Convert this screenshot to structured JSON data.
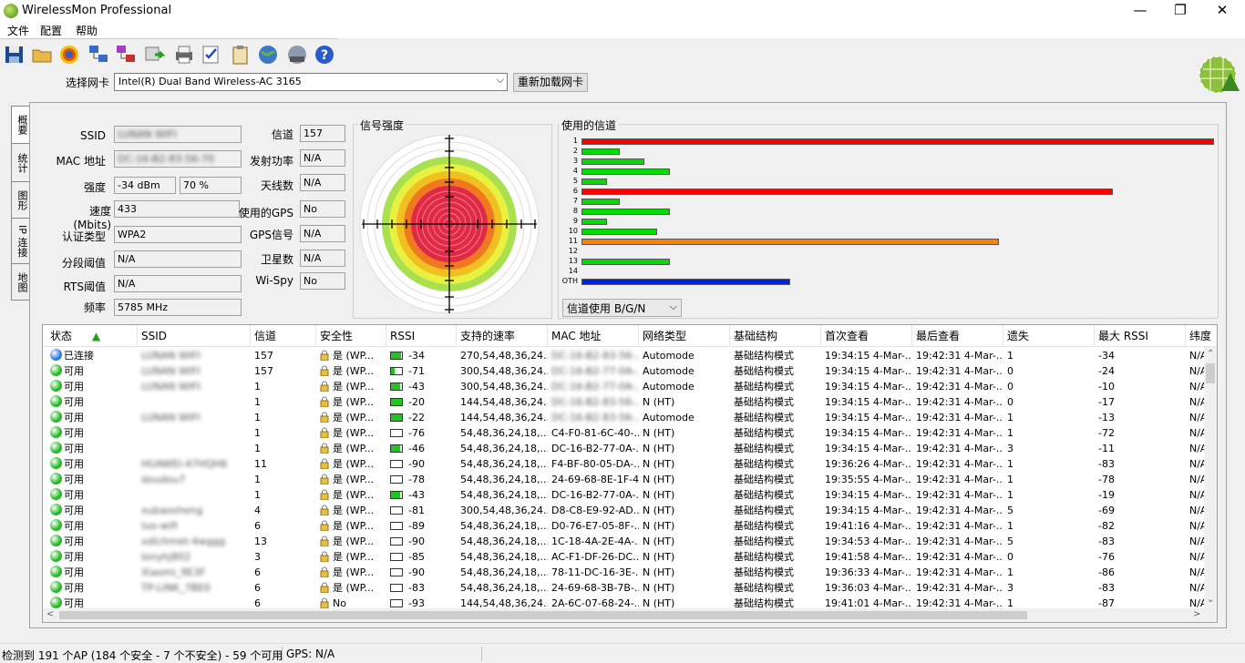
{
  "window": {
    "title": "WirelessMon Professional",
    "minimize": "—",
    "maximize": "❐",
    "close": "✕"
  },
  "menu": [
    "文件",
    "配置",
    "帮助"
  ],
  "toolbar": {
    "icons": [
      "save-icon",
      "open-folder-icon",
      "target-icon",
      "network-config-icon",
      "network-color-icon",
      "export-green-icon",
      "print-icon",
      "checklist-icon",
      "clipboard-icon",
      "globe-icon",
      "globe-gray-icon",
      "help-icon"
    ]
  },
  "nic": {
    "label": "选择网卡",
    "value": "Intel(R) Dual Band Wireless-AC 3165",
    "reload": "重新加载网卡"
  },
  "tabs": [
    "概要",
    "统计",
    "图形",
    "IP 连接",
    "地图"
  ],
  "info": {
    "ssid_label": "SSID",
    "ssid": "LUNAN WIFI",
    "mac_label": "MAC 地址",
    "mac": "DC-16-B2-83-56-70",
    "strength_label": "强度",
    "strength_dbm": "-34 dBm",
    "strength_pct": "70 %",
    "speed_label": "速度(Mbits)",
    "speed": "433",
    "auth_label": "认证类型",
    "auth": "WPA2",
    "frag_label": "分段阈值",
    "frag": "N/A",
    "rts_label": "RTS阈值",
    "rts": "N/A",
    "freq_label": "频率",
    "freq": "5785 MHz",
    "channel_label": "信道",
    "channel": "157",
    "tx_label": "发射功率",
    "tx": "N/A",
    "antenna_label": "天线数",
    "antenna": "N/A",
    "gps_used_label": "使用的GPS",
    "gps_used": "No",
    "gps_signal_label": "GPS信号",
    "gps_signal": "N/A",
    "satellites_label": "卫星数",
    "satellites": "N/A",
    "wispy_label": "Wi-Spy",
    "wispy": "No"
  },
  "signal_title": "信号强度",
  "chart_data": {
    "type": "bar",
    "title": "使用的信道",
    "categories": [
      "1",
      "2",
      "3",
      "4",
      "5",
      "6",
      "7",
      "8",
      "9",
      "10",
      "11",
      "12",
      "13",
      "14",
      "OTH"
    ],
    "values": [
      100,
      6,
      10,
      14,
      4,
      84,
      6,
      14,
      4,
      12,
      66,
      0,
      14,
      0,
      33
    ],
    "colors": [
      "#ff0000",
      "#00dd00",
      "#00dd00",
      "#00dd00",
      "#00dd00",
      "#ff0000",
      "#00dd00",
      "#00dd00",
      "#00dd00",
      "#00dd00",
      "#ff8000",
      "#00dd00",
      "#00dd00",
      "#00dd00",
      "#0022ee"
    ],
    "xlim": [
      0,
      100
    ]
  },
  "channel_select": "信道使用 B/G/N",
  "table": {
    "headers": [
      "状态",
      "SSID",
      "信道",
      "安全性",
      "RSSI",
      "支持的速率",
      "MAC 地址",
      "网络类型",
      "基础结构",
      "首次查看",
      "最后查看",
      "遗失",
      "最大 RSSI",
      "纬度"
    ],
    "rows": [
      {
        "status": "已连接",
        "dot": "#2a7ae0",
        "ssid": "LUNAN WIFI",
        "blur": true,
        "channel": "157",
        "sec": "是 (WP...",
        "rssi": "-34",
        "fill": 0.9,
        "rates": "270,54,48,36,24...",
        "mac": "DC-16-B2-83-56-...",
        "macblur": true,
        "type": "Automode",
        "infra": "基础结构模式",
        "first": "19:34:15 4-Mar-...",
        "last": "19:42:31 4-Mar-...",
        "lost": "1",
        "max": "-34",
        "lat": "N/A"
      },
      {
        "status": "可用",
        "dot": "#22b822",
        "ssid": "LUNAN WIFI",
        "blur": true,
        "channel": "157",
        "sec": "是 (WP...",
        "rssi": "-71",
        "fill": 0.3,
        "rates": "300,54,48,36,24...",
        "mac": "DC-16-B2-77-0A-...",
        "macblur": true,
        "type": "Automode",
        "infra": "基础结构模式",
        "first": "19:34:15 4-Mar-...",
        "last": "19:42:31 4-Mar-...",
        "lost": "0",
        "max": "-24",
        "lat": "N/A"
      },
      {
        "status": "可用",
        "dot": "#22b822",
        "ssid": "LUNAN WIFI",
        "blur": true,
        "channel": "1",
        "sec": "是 (WP...",
        "rssi": "-43",
        "fill": 0.8,
        "rates": "300,54,48,36,24...",
        "mac": "DC-16-B2-77-0A-...",
        "macblur": true,
        "type": "Automode",
        "infra": "基础结构模式",
        "first": "19:34:15 4-Mar-...",
        "last": "19:42:31 4-Mar-...",
        "lost": "0",
        "max": "-10",
        "lat": "N/A"
      },
      {
        "status": "可用",
        "dot": "#22b822",
        "ssid": "",
        "blur": false,
        "channel": "1",
        "sec": "是 (WP...",
        "rssi": "-20",
        "fill": 1.0,
        "rates": "144,54,48,36,24...",
        "mac": "DC-16-B2-83-56-...",
        "macblur": true,
        "type": "N (HT)",
        "infra": "基础结构模式",
        "first": "19:34:15 4-Mar-...",
        "last": "19:42:31 4-Mar-...",
        "lost": "0",
        "max": "-17",
        "lat": "N/A"
      },
      {
        "status": "可用",
        "dot": "#22b822",
        "ssid": "LUNAN WIFI",
        "blur": true,
        "channel": "1",
        "sec": "是 (WP...",
        "rssi": "-22",
        "fill": 1.0,
        "rates": "144,54,48,36,24...",
        "mac": "DC-16-B2-83-56-...",
        "macblur": true,
        "type": "Automode",
        "infra": "基础结构模式",
        "first": "19:34:15 4-Mar-...",
        "last": "19:42:31 4-Mar-...",
        "lost": "1",
        "max": "-13",
        "lat": "N/A"
      },
      {
        "status": "可用",
        "dot": "#22b822",
        "ssid": "",
        "blur": false,
        "channel": "1",
        "sec": "是 (WP...",
        "rssi": "-76",
        "fill": 0.0,
        "rates": "54,48,36,24,18,...",
        "mac": "C4-F0-81-6C-40-...",
        "macblur": false,
        "type": "N (HT)",
        "infra": "基础结构模式",
        "first": "19:34:15 4-Mar-...",
        "last": "19:42:31 4-Mar-...",
        "lost": "1",
        "max": "-72",
        "lat": "N/A"
      },
      {
        "status": "可用",
        "dot": "#22b822",
        "ssid": "",
        "blur": false,
        "channel": "1",
        "sec": "是 (WP...",
        "rssi": "-46",
        "fill": 0.8,
        "rates": "54,48,36,24,18,...",
        "mac": "DC-16-B2-77-0A-...",
        "macblur": false,
        "type": "N (HT)",
        "infra": "基础结构模式",
        "first": "19:34:15 4-Mar-...",
        "last": "19:42:31 4-Mar-...",
        "lost": "3",
        "max": "-11",
        "lat": "N/A"
      },
      {
        "status": "可用",
        "dot": "#22b822",
        "ssid": "HUAWEI-47HQH6",
        "blur": true,
        "channel": "11",
        "sec": "是 (WP...",
        "rssi": "-90",
        "fill": 0.0,
        "rates": "54,48,36,24,18,...",
        "mac": "F4-BF-80-05-DA-...",
        "macblur": false,
        "type": "N (HT)",
        "infra": "基础结构模式",
        "first": "19:36:26 4-Mar-...",
        "last": "19:42:31 4-Mar-...",
        "lost": "1",
        "max": "-83",
        "lat": "N/A"
      },
      {
        "status": "可用",
        "dot": "#22b822",
        "ssid": "doudou7",
        "blur": true,
        "channel": "1",
        "sec": "是 (WP...",
        "rssi": "-78",
        "fill": 0.0,
        "rates": "54,48,36,24,18,...",
        "mac": "24-69-68-8E-1F-48",
        "macblur": false,
        "type": "N (HT)",
        "infra": "基础结构模式",
        "first": "19:35:55 4-Mar-...",
        "last": "19:42:31 4-Mar-...",
        "lost": "1",
        "max": "-78",
        "lat": "N/A"
      },
      {
        "status": "可用",
        "dot": "#22b822",
        "ssid": "",
        "blur": false,
        "channel": "1",
        "sec": "是 (WP...",
        "rssi": "-43",
        "fill": 0.8,
        "rates": "54,48,36,24,18,...",
        "mac": "DC-16-B2-77-0A-...",
        "macblur": false,
        "type": "N (HT)",
        "infra": "基础结构模式",
        "first": "19:34:15 4-Mar-...",
        "last": "19:42:31 4-Mar-...",
        "lost": "1",
        "max": "-19",
        "lat": "N/A"
      },
      {
        "status": "可用",
        "dot": "#22b822",
        "ssid": "xubaosheng",
        "blur": true,
        "channel": "4",
        "sec": "是 (WP...",
        "rssi": "-81",
        "fill": 0.0,
        "rates": "300,54,48,36,24...",
        "mac": "D8-C8-E9-92-AD...",
        "macblur": false,
        "type": "N (HT)",
        "infra": "基础结构模式",
        "first": "19:34:15 4-Mar-...",
        "last": "19:42:31 4-Mar-...",
        "lost": "5",
        "max": "-69",
        "lat": "N/A"
      },
      {
        "status": "可用",
        "dot": "#22b822",
        "ssid": "luo-wifi",
        "blur": true,
        "channel": "6",
        "sec": "是 (WP...",
        "rssi": "-89",
        "fill": 0.0,
        "rates": "54,48,36,24,18,...",
        "mac": "D0-76-E7-05-8F-...",
        "macblur": false,
        "type": "N (HT)",
        "infra": "基础结构模式",
        "first": "19:41:16 4-Mar-...",
        "last": "19:42:31 4-Mar-...",
        "lost": "1",
        "max": "-82",
        "lat": "N/A"
      },
      {
        "status": "可用",
        "dot": "#22b822",
        "ssid": "xdlchmet-4wggg",
        "blur": true,
        "channel": "13",
        "sec": "是 (WP...",
        "rssi": "-90",
        "fill": 0.0,
        "rates": "54,48,36,24,18,...",
        "mac": "1C-18-4A-2E-4A-...",
        "macblur": false,
        "type": "N (HT)",
        "infra": "基础结构模式",
        "first": "19:34:53 4-Mar-...",
        "last": "19:42:31 4-Mar-...",
        "lost": "5",
        "max": "-83",
        "lat": "N/A"
      },
      {
        "status": "可用",
        "dot": "#22b822",
        "ssid": "lonyhj802",
        "blur": true,
        "channel": "3",
        "sec": "是 (WP...",
        "rssi": "-85",
        "fill": 0.0,
        "rates": "54,48,36,24,18,...",
        "mac": "AC-F1-DF-26-DC...",
        "macblur": false,
        "type": "N (HT)",
        "infra": "基础结构模式",
        "first": "19:41:58 4-Mar-...",
        "last": "19:42:31 4-Mar-...",
        "lost": "0",
        "max": "-76",
        "lat": "N/A"
      },
      {
        "status": "可用",
        "dot": "#22b822",
        "ssid": "Xiaomi_9E3F",
        "blur": true,
        "channel": "6",
        "sec": "是 (WP...",
        "rssi": "-90",
        "fill": 0.0,
        "rates": "54,48,36,24,18,...",
        "mac": "78-11-DC-16-3E-...",
        "macblur": false,
        "type": "N (HT)",
        "infra": "基础结构模式",
        "first": "19:36:33 4-Mar-...",
        "last": "19:42:31 4-Mar-...",
        "lost": "1",
        "max": "-86",
        "lat": "N/A"
      },
      {
        "status": "可用",
        "dot": "#22b822",
        "ssid": "TP-LINK_7BE0",
        "blur": true,
        "channel": "6",
        "sec": "是 (WP...",
        "rssi": "-83",
        "fill": 0.0,
        "rates": "54,48,36,24,18,...",
        "mac": "24-69-68-3B-7B-...",
        "macblur": false,
        "type": "N (HT)",
        "infra": "基础结构模式",
        "first": "19:36:03 4-Mar-...",
        "last": "19:42:31 4-Mar-...",
        "lost": "3",
        "max": "-83",
        "lat": "N/A"
      },
      {
        "status": "可用",
        "dot": "#22b822",
        "ssid": "",
        "blur": false,
        "channel": "6",
        "sec": "No",
        "rssi": "-93",
        "fill": 0.0,
        "rates": "144,54,48,36,24...",
        "mac": "2A-6C-07-68-24-...",
        "macblur": false,
        "type": "N (HT)",
        "infra": "基础结构模式",
        "first": "19:41:01 4-Mar-...",
        "last": "19:42:31 4-Mar-...",
        "lost": "1",
        "max": "-87",
        "lat": "N/A"
      }
    ]
  },
  "status": {
    "summary": "检测到 191 个AP (184 个安全 - 7 个不安全) - 59 个可用",
    "gps": "GPS: N/A"
  }
}
